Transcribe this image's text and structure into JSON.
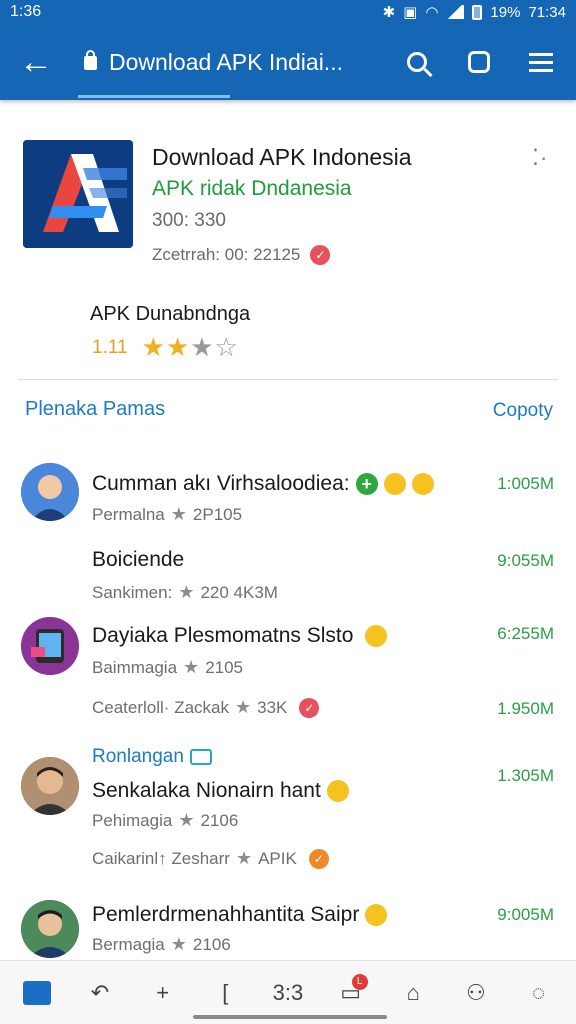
{
  "status_bar": {
    "time": "1:36",
    "battery": "19%",
    "clock_right": "71:34"
  },
  "toolbar": {
    "back_icon": "back-arrow-icon",
    "tab_title": "Download APK Indiai...",
    "icons": [
      "search-icon",
      "tabs-icon",
      "menu-icon"
    ]
  },
  "app": {
    "title": "Download APK Indonesia",
    "subtitle": "APK ridak Dndanesia",
    "version": "300: 330",
    "date": "Zcetrrah: 00: 22125",
    "rating_title": "APK Dunabndnga",
    "rating_value": "1.11",
    "stars_filled": 2,
    "stars_half": 1,
    "stars_total": 4,
    "more_icon": "more-dots-icon"
  },
  "section": {
    "title": "Plenaka Pamas",
    "action": "Copoty"
  },
  "items": [
    {
      "title": "Cumman akı Virhsaloodiea:",
      "meta": "Permalna",
      "meta_rating": "2P105",
      "size": "1:005M"
    },
    {
      "title": "Boiciende",
      "meta": "Sankimen:",
      "meta_rating": "220 4K3M",
      "size": "9:055M"
    },
    {
      "title": "Dayiaka Plesmomatns Slsto",
      "meta": "Baimmagia",
      "meta_rating": "2105",
      "size": "6:255M",
      "extra_meta": "Ceaterloll· Zackak",
      "extra_rating": "33K",
      "extra_size": "1.950M"
    },
    {
      "tag": "Ronlangan",
      "title": "Senkalaka Nionairn hant",
      "meta": "Pehimagia",
      "meta_rating": "2106",
      "size": "1.305M",
      "extra_meta": "Caikarinl↑ Zesharr",
      "extra_rating": "APIK"
    },
    {
      "title": "Pemlerdrmenahhantita Saipr",
      "meta": "Bermagia",
      "meta_rating": "2106",
      "size": "9:005M"
    }
  ],
  "bottom_nav": {
    "center_label": "3:3"
  },
  "colors": {
    "primary": "#1567b6",
    "accent_green": "#2a9f46",
    "link_blue": "#1b7bc7",
    "star": "#f2b01e"
  }
}
